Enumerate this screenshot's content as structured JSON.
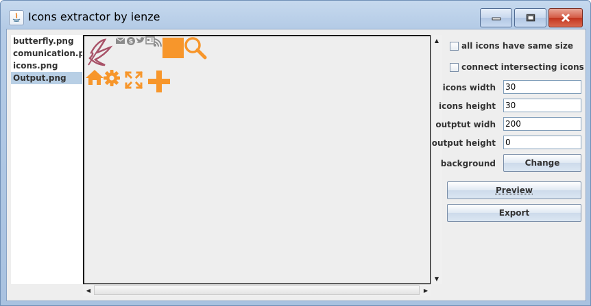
{
  "window": {
    "title": "Icons extractor by ienze"
  },
  "titlebar_buttons": {
    "minimize": "minimize",
    "maximize": "maximize",
    "close": "close"
  },
  "files": [
    {
      "name": "butterfly.png",
      "selected": false
    },
    {
      "name": "comunication.png",
      "selected": false
    },
    {
      "name": "icons.png",
      "selected": false
    },
    {
      "name": "Output.png",
      "selected": true
    }
  ],
  "options": {
    "same_size_label": "all icons have same size",
    "same_size_checked": false,
    "connect_label": "connect intersecting icons",
    "connect_checked": false
  },
  "fields": {
    "icons_width_label": "icons width",
    "icons_width_value": "30",
    "icons_height_label": "icons height",
    "icons_height_value": "30",
    "output_width_label": "outptut widh",
    "output_width_value": "200",
    "output_height_label": "output height",
    "output_height_value": "0",
    "background_label": "background"
  },
  "buttons": {
    "change": "Change",
    "preview": "Preview",
    "export": "Export"
  },
  "preview_icons": [
    "butterfly-sketch-icon",
    "mail-icon",
    "skype-icon",
    "twitter-icon",
    "contact-card-icon",
    "rss-icon",
    "orange-square-icon",
    "search-icon",
    "home-icon",
    "gear-icon",
    "fullscreen-icon",
    "plus-icon"
  ],
  "colors": {
    "accent_orange": "#f7962b",
    "butterfly": "#a85268",
    "gray_icon": "#8a8a8a",
    "selection": "#b8cfe5"
  }
}
